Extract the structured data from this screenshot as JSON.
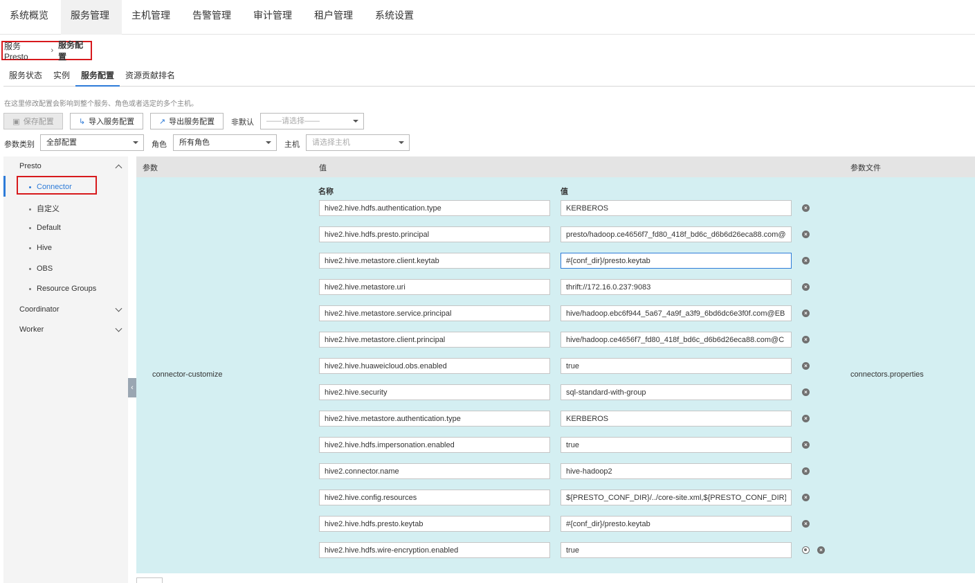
{
  "topnav": {
    "items": [
      "系统概览",
      "服务管理",
      "主机管理",
      "告警管理",
      "审计管理",
      "租户管理",
      "系统设置"
    ],
    "active_index": 1
  },
  "breadcrumb": {
    "parent": "服务 Presto",
    "separator": "›",
    "current": "服务配置"
  },
  "subtabs": {
    "items": [
      "服务状态",
      "实例",
      "服务配置",
      "资源贡献排名"
    ],
    "active_index": 2
  },
  "hint": "在这里修改配置会影响到整个服务、角色或者选定的多个主机。",
  "toolbar": {
    "save_label": "保存配置",
    "import_label": "导入服务配置",
    "export_label": "导出服务配置",
    "non_default_label": "非默认",
    "non_default_placeholder": "——请选择——"
  },
  "filters": {
    "category_label": "参数类别",
    "category_value": "全部配置",
    "role_label": "角色",
    "role_value": "所有角色",
    "host_label": "主机",
    "host_placeholder": "请选择主机"
  },
  "sidebar": {
    "groups": [
      {
        "label": "Presto",
        "expanded": true,
        "items": [
          "Connector",
          "自定义",
          "Default",
          "Hive",
          "OBS",
          "Resource Groups"
        ],
        "active_item": 0
      },
      {
        "label": "Coordinator",
        "expanded": false
      },
      {
        "label": "Worker",
        "expanded": false
      }
    ]
  },
  "table": {
    "headers": {
      "param": "参数",
      "value": "值",
      "file": "参数文件"
    },
    "param_name": "connector-customize",
    "param_file": "connectors.properties",
    "sub_headers": {
      "name": "名称",
      "value": "值"
    },
    "rows": [
      {
        "name": "hive2.hive.hdfs.authentication.type",
        "value": "KERBEROS"
      },
      {
        "name": "hive2.hive.hdfs.presto.principal",
        "value": "presto/hadoop.ce4656f7_fd80_418f_bd6c_d6b6d26eca88.com@"
      },
      {
        "name": "hive2.hive.metastore.client.keytab",
        "value": "#{conf_dir}/presto.keytab"
      },
      {
        "name": "hive2.hive.metastore.uri",
        "value": "thrift://172.16.0.237:9083"
      },
      {
        "name": "hive2.hive.metastore.service.principal",
        "value": "hive/hadoop.ebc6f944_5a67_4a9f_a3f9_6bd6dc6e3f0f.com@EB"
      },
      {
        "name": "hive2.hive.metastore.client.principal",
        "value": "hive/hadoop.ce4656f7_fd80_418f_bd6c_d6b6d26eca88.com@C"
      },
      {
        "name": "hive2.hive.huaweicloud.obs.enabled",
        "value": "true"
      },
      {
        "name": "hive2.hive.security",
        "value": "sql-standard-with-group"
      },
      {
        "name": "hive2.hive.metastore.authentication.type",
        "value": "KERBEROS"
      },
      {
        "name": "hive2.hive.hdfs.impersonation.enabled",
        "value": "true"
      },
      {
        "name": "hive2.connector.name",
        "value": "hive-hadoop2"
      },
      {
        "name": "hive2.hive.config.resources",
        "value": "${PRESTO_CONF_DIR}/../core-site.xml,${PRESTO_CONF_DIR}/../h"
      },
      {
        "name": "hive2.hive.hdfs.presto.keytab",
        "value": "#{conf_dir}/presto.keytab"
      },
      {
        "name": "hive2.hive.hdfs.wire-encryption.enabled",
        "value": "true"
      }
    ],
    "focused_row": 2
  },
  "icons": {
    "save": "save-icon",
    "import": "import-icon",
    "export": "export-icon",
    "delete": "remove-circle-icon",
    "add": "add-circle-icon",
    "collapse": "chevron-left-icon"
  },
  "colors": {
    "accent": "#2d7bd8",
    "highlight_border": "#d7191c",
    "table_body_bg": "#d4eff2",
    "table_head_bg": "#e4e4e4"
  }
}
